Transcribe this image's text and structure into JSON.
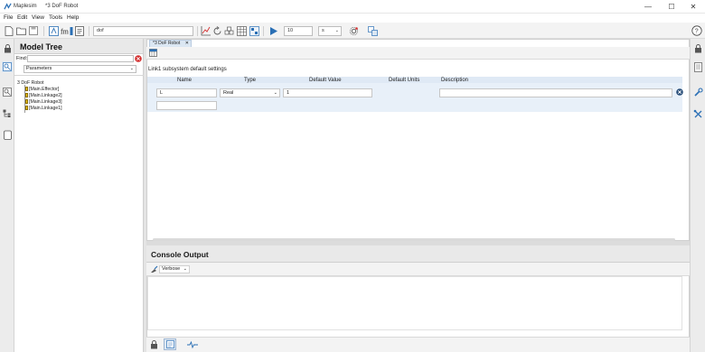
{
  "window": {
    "app_title": "Maplesim",
    "doc_title": "*3 DoF Robot",
    "minimize": "—",
    "maximize": "☐",
    "close": "✕"
  },
  "menu": [
    "File",
    "Edit",
    "View",
    "Tools",
    "Help"
  ],
  "toolbar": {
    "search_value": "dof",
    "sim_time": "10",
    "units": "s"
  },
  "model_tree": {
    "title": "Model Tree",
    "find_label": "Find:",
    "find_value": "",
    "filter_value": "Parameters",
    "root": "3 DoF Robot",
    "items": [
      "[Main.Effector]",
      "[Main.Linkage2]",
      "[Main.Linkage3]",
      "[Main.Linkage1]"
    ]
  },
  "editor": {
    "tab_label": "*3 DoF Robot",
    "section_title": "Link1 subsystem default settings",
    "columns": [
      "Name",
      "Type",
      "Default Value",
      "Default Units",
      "Description"
    ],
    "row": {
      "name": "L",
      "type": "Real",
      "default_value": "1",
      "default_units": "",
      "description": ""
    },
    "new_row_name": ""
  },
  "console": {
    "title": "Console Output",
    "verbosity": "Verbose"
  },
  "colors": {
    "accent_blue": "#2a6fb5",
    "grid_header": "#dfe9f5",
    "grid_row": "#e8f0f9",
    "error_red": "#d32f2f"
  }
}
